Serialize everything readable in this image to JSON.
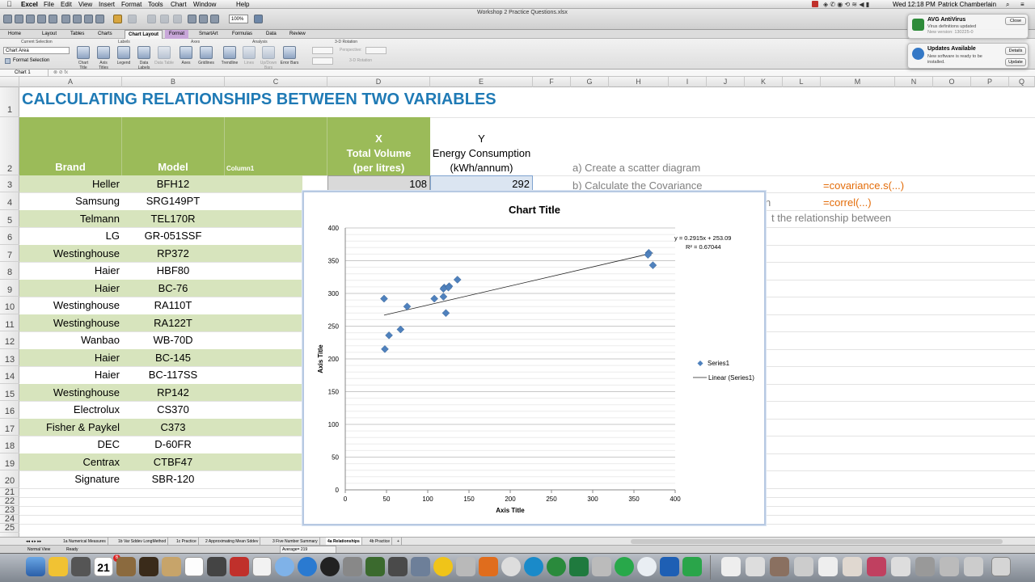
{
  "menubar": {
    "apple": "",
    "app": "Excel",
    "items": [
      "File",
      "Edit",
      "View",
      "Insert",
      "Format",
      "Tools",
      "Chart",
      "Window",
      "Help"
    ],
    "clock": "Wed 12:18 PM",
    "user": "Patrick Chamberlain"
  },
  "window": {
    "title": "Workshop 2 Practice Questions.xlsx",
    "zoom": "100%"
  },
  "ribbon_tabs": [
    "Home",
    "Layout",
    "Tables",
    "Charts",
    "Chart Layout",
    "Format",
    "SmartArt",
    "Formulas",
    "Data",
    "Review"
  ],
  "ribbon_active": "Chart Layout",
  "ribbon": {
    "groups": [
      "Current Selection",
      "Labels",
      "Axes",
      "Analysis",
      "3-D Rotation"
    ],
    "selection": "Chart Area",
    "format_selection": "Format Selection",
    "buttons": [
      "Chart Title",
      "Axis Titles",
      "Legend",
      "Data Labels",
      "Data Table",
      "Axes",
      "Gridlines",
      "Trendline",
      "Lines",
      "Up/Down Bars",
      "Error Bars"
    ],
    "perspective": "Perspective:",
    "rotation": "3-D Rotation"
  },
  "formula_bar": {
    "name_box": "Chart 1"
  },
  "columns": [
    "A",
    "B",
    "C",
    "D",
    "E",
    "F",
    "G",
    "H",
    "I",
    "J",
    "K",
    "L",
    "M",
    "N",
    "O",
    "P",
    "Q"
  ],
  "rows": [
    "1",
    "2",
    "3",
    "4",
    "5",
    "6",
    "7",
    "8",
    "9",
    "10",
    "11",
    "12",
    "13",
    "14",
    "15",
    "16",
    "17",
    "18",
    "19",
    "20",
    "21",
    "22",
    "23",
    "24",
    "25"
  ],
  "sheet": {
    "title": "CALCULATING RELATIONSHIPS BETWEEN TWO VARIABLES",
    "headers": {
      "brand": "Brand",
      "model": "Model",
      "column1": "Column1",
      "x_line1": "X",
      "x_line2": "Total Volume",
      "x_line3": "(per litres)",
      "y_line1": "Y",
      "y_line2": "Energy Consumption",
      "y_line3": "(kWh/annum)"
    },
    "data": [
      {
        "brand": "Heller",
        "model": "BFH12"
      },
      {
        "brand": "Samsung",
        "model": "SRG149PT"
      },
      {
        "brand": "Telmann",
        "model": "TEL170R"
      },
      {
        "brand": "LG",
        "model": "GR-051SSF"
      },
      {
        "brand": "Westinghouse",
        "model": "RP372"
      },
      {
        "brand": "Haier",
        "model": "HBF80"
      },
      {
        "brand": "Haier",
        "model": "BC-76"
      },
      {
        "brand": "Westinghouse",
        "model": "RA110T"
      },
      {
        "brand": "Westinghouse",
        "model": "RA122T"
      },
      {
        "brand": "Wanbao",
        "model": "WB-70D"
      },
      {
        "brand": "Haier",
        "model": "BC-145"
      },
      {
        "brand": "Haier",
        "model": "BC-117SS"
      },
      {
        "brand": "Westinghouse",
        "model": "RP142"
      },
      {
        "brand": "Electrolux",
        "model": "CS370"
      },
      {
        "brand": "Fisher & Paykel",
        "model": "C373"
      },
      {
        "brand": "DEC",
        "model": "D-60FR"
      },
      {
        "brand": "Centrax",
        "model": "CTBF47"
      },
      {
        "brand": "Signature",
        "model": "SBR-120"
      }
    ],
    "d3": "108",
    "e3": "292",
    "tasks": {
      "a": "a) Create a scatter diagram",
      "b": "b) Calculate the Covariance",
      "c_partial": "n",
      "d_partial": "t the relationship between"
    },
    "formulas": {
      "cov": "=covariance.s(...)",
      "correl": "=correl(...)"
    }
  },
  "chart_data": {
    "type": "scatter",
    "title": "Chart Title",
    "xlabel": "Axis Title",
    "ylabel": "Axis Title",
    "xlim": [
      0,
      400
    ],
    "ylim": [
      0,
      400
    ],
    "xticks": [
      0,
      50,
      100,
      150,
      200,
      250,
      300,
      350,
      400
    ],
    "yticks": [
      0,
      50,
      100,
      150,
      200,
      250,
      300,
      350,
      400
    ],
    "grid": "horizontal",
    "legend_position": "right",
    "series": [
      {
        "name": "Series1",
        "x": [
          108,
          120,
          126,
          136,
          368,
          373,
          367,
          47,
          75,
          53,
          119,
          122,
          48,
          67,
          125,
          119
        ],
        "y": [
          292,
          309,
          311,
          321,
          362,
          343,
          359,
          292,
          280,
          236,
          295,
          270,
          215,
          245,
          309,
          307
        ],
        "color": "#4f81bd"
      }
    ],
    "trendline": {
      "name": "Linear (Series1)",
      "slope": 0.2915,
      "intercept": 253.09,
      "x_range": [
        47,
        373
      ],
      "equation": "y = 0.2915x + 253.09",
      "r2": "R² = 0.67044"
    }
  },
  "sheet_tabs": [
    "1a Numerical Measures",
    "1b Var Sddev LongMethod",
    "1c Practice",
    "2 Approximating Mean Sddev",
    "3 Five Number Summary",
    "4a Relationships",
    "4b Practice"
  ],
  "sheet_tabs_active": "4a Relationships",
  "status": {
    "view": "Normal View",
    "ready": "Ready",
    "average": "Average= 219"
  },
  "notifications": [
    {
      "title": "AVG AntiVirus",
      "line1": "Virus definitions updated",
      "line2": "New version: 130225-0",
      "button": "Close"
    },
    {
      "title": "Updates Available",
      "line1": "New software is ready to be",
      "line2": "installed.",
      "button1": "Details",
      "button2": "Update"
    }
  ],
  "dock": {
    "calendar_day": "21",
    "badge": "6"
  }
}
